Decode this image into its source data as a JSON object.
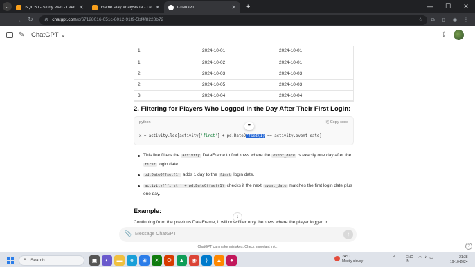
{
  "browser": {
    "tabs": [
      {
        "title": "SQL 50 - Study Plan - LeetCode",
        "fav_color": "#f89f1b"
      },
      {
        "title": "Game Play Analysis IV - LeetCo",
        "fav_color": "#f89f1b"
      },
      {
        "title": "ChatGPT",
        "fav_color": "#ffffff"
      }
    ],
    "url_host": "chatgpt.com",
    "url_path": "/c/67128016-051c-8012-91f9-5bf4f8228b72"
  },
  "header": {
    "model": "ChatGPT ⌄"
  },
  "table": {
    "rows": [
      [
        "1",
        "2024-10-01",
        "2024-10-01"
      ],
      [
        "1",
        "2024-10-02",
        "2024-10-01"
      ],
      [
        "2",
        "2024-10-03",
        "2024-10-03"
      ],
      [
        "2",
        "2024-10-05",
        "2024-10-03"
      ],
      [
        "3",
        "2024-10-04",
        "2024-10-04"
      ]
    ]
  },
  "section_heading": "2. Filtering for Players Who Logged in the Day After Their First Login:",
  "code_block": {
    "language": "python",
    "copy_label": "Copy code",
    "code_before": "x = activity.loc[activity[",
    "code_str": "'first'",
    "code_mid": "] + pd.DateO",
    "code_highlight": "ffset(1)",
    "code_after": " == activity.event_date]",
    "quote_icon": "❞"
  },
  "bullets": {
    "b1_pre": "This line filters the ",
    "b1_code1": "activity",
    "b1_mid": " DataFrame to find rows where the ",
    "b1_code2": "event_date",
    "b1_mid2": " is exactly one day after the ",
    "b1_code3": "first",
    "b1_post": " login date.",
    "b2_code1": "pd.DateOffset(1)",
    "b2_mid": " adds 1 day to the ",
    "b2_code2": "first",
    "b2_post": " login date.",
    "b3_code1": "activity['first'] + pd.DateOffset(1)",
    "b3_mid": " checks if the next ",
    "b3_code2": "event_date",
    "b3_post": " matches the first login date plus one day."
  },
  "example_heading": "Example:",
  "example_para": "Continuing from the previous DataFrame, it will now filter only the rows where the player logged in",
  "composer": {
    "placeholder": "Message ChatGPT"
  },
  "disclaimer": "ChatGPT can make mistakes. Check important info.",
  "taskbar": {
    "search_label": "Search",
    "weather_temp": "24°C",
    "weather_desc": "Mostly cloudy",
    "lang_1": "ENG",
    "lang_2": "IN",
    "time": "21:38",
    "date": "19-10-2024"
  }
}
